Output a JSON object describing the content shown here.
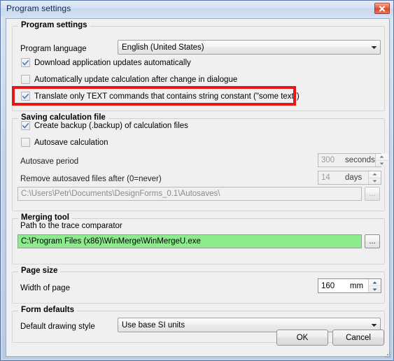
{
  "window": {
    "title": "Program settings",
    "close_icon": "close-icon"
  },
  "groups": {
    "program_settings": {
      "title": "Program settings",
      "language_label": "Program language",
      "language_value": "English (United States)",
      "checkboxes": [
        {
          "label": "Download application updates automatically",
          "checked": true
        },
        {
          "label": "Automatically update calculation after change in dialogue",
          "checked": false
        },
        {
          "label": "Translate only TEXT commands that contains string constant (\"some text\")",
          "checked": true
        }
      ]
    },
    "saving": {
      "title": "Saving calculation file",
      "checkboxes": [
        {
          "label": "Create backup (.backup) of calculation files",
          "checked": true
        },
        {
          "label": "Autosave calculation",
          "checked": false
        }
      ],
      "autosave_period_label": "Autosave period",
      "autosave_period_value": "300",
      "autosave_period_unit": "seconds",
      "remove_after_label": "Remove autosaved files after (0=never)",
      "remove_after_value": "14",
      "remove_after_unit": "days",
      "autosave_path": "C:\\Users\\Petr\\Documents\\DesignForms_0.1\\Autosaves\\",
      "browse_label": "..."
    },
    "merging": {
      "title": "Merging tool",
      "path_label": "Path to the trace comparator",
      "path_value": "C:\\Program Files (x86)\\WinMerge\\WinMergeU.exe",
      "browse_label": "..."
    },
    "page_size": {
      "title": "Page size",
      "width_label": "Width of page",
      "width_value": "160",
      "width_unit": "mm"
    },
    "form_defaults": {
      "title": "Form defaults",
      "style_label": "Default drawing style",
      "style_value": "Use base SI units"
    }
  },
  "buttons": {
    "ok": "OK",
    "cancel": "Cancel"
  },
  "colors": {
    "highlight_red": "#e81717",
    "path_green": "#8ceb8c",
    "title_blue": "#0f2d54"
  }
}
